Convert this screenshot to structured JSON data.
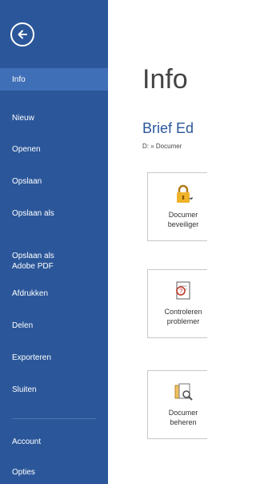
{
  "sidebar": {
    "back_icon": "arrow-left-circle-icon",
    "items": [
      {
        "label": "Info",
        "active": true
      },
      {
        "label": "Nieuw"
      },
      {
        "label": "Openen"
      },
      {
        "label": "Opslaan"
      },
      {
        "label": "Opslaan als"
      },
      {
        "label": "Opslaan als\nAdobe PDF"
      },
      {
        "label": "Afdrukken"
      },
      {
        "label": "Delen"
      },
      {
        "label": "Exporteren"
      },
      {
        "label": "Sluiten"
      },
      {
        "label": "Account"
      },
      {
        "label": "Opties"
      }
    ]
  },
  "main": {
    "title": "Info",
    "document_title": "Brief Ed",
    "document_path": "D: » Documer",
    "tiles": [
      {
        "icon": "lock-key-icon",
        "label_line1": "Documer",
        "label_line2": "beveiliger"
      },
      {
        "icon": "inspect-document-icon",
        "label_line1": "Controleren",
        "label_line2": "problemer"
      },
      {
        "icon": "manage-versions-icon",
        "label_line1": "Documer",
        "label_line2": "beheren"
      }
    ]
  },
  "colors": {
    "sidebar_bg": "#2b579a",
    "active_item_bg": "#3f6fb7",
    "accent": "#2b579a"
  }
}
